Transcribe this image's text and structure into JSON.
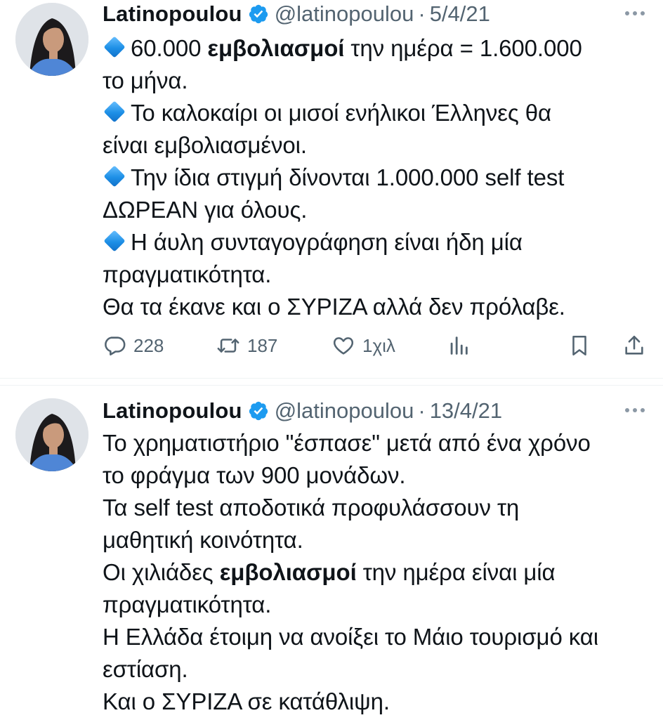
{
  "tweets": [
    {
      "author": "Latinopoulou",
      "handle": "@latinopoulou",
      "separator": "·",
      "date": "5/4/21",
      "lines": {
        "l1_pre": "60.000 ",
        "l1_bold": "εμβολιασμοί",
        "l1_post": " την ημέρα = 1.600.000",
        "l2": "το μήνα.",
        "l3": "Το καλοκαίρι οι μισοί ενήλικοι Έλληνες θα",
        "l4": "είναι εμβολιασμένοι.",
        "l5": "Την ίδια στιγμή δίνονται 1.000.000 self test",
        "l6": "ΔΩΡΕΑΝ για όλους.",
        "l7": "Η άυλη συνταγογράφηση είναι ήδη μία",
        "l8": "πραγματικότητα.",
        "l9": "Θα τα έκανε και ο ΣΥΡΙΖΑ αλλά δεν πρόλαβε."
      },
      "stats": {
        "replies": "228",
        "retweets": "187",
        "likes": "1χιλ"
      }
    },
    {
      "author": "Latinopoulou",
      "handle": "@latinopoulou",
      "separator": "·",
      "date": "13/4/21",
      "lines": {
        "l1": "Το χρηματιστήριο \"έσπασε\" μετά από ένα χρόνο",
        "l2": "το φράγμα των 900 μονάδων.",
        "l3": "Τα self test αποδοτικά προφυλάσσουν τη",
        "l4": "μαθητική κοινότητα.",
        "l5_pre": "Οι χιλιάδες ",
        "l5_bold": "εμβολιασμοί",
        "l5_post": " την ημέρα είναι μία",
        "l6": "πραγματικότητα.",
        "l7": "Η Ελλάδα έτοιμη να ανοίξει το Μάιο τουρισμό και",
        "l8": "εστίαση.",
        "l9": "Και ο ΣΥΡΙΖΑ σε κατάθλιψη."
      }
    }
  ],
  "icons": {
    "verified": "verified-badge-icon",
    "bullet": "small-blue-diamond-emoji",
    "reply": "reply-icon",
    "retweet": "retweet-icon",
    "like": "heart-icon",
    "views": "views-chart-icon",
    "bookmark": "bookmark-icon",
    "share": "share-icon"
  },
  "colors": {
    "text": "#0f1419",
    "muted": "#536471",
    "verified": "#1d9bf0",
    "divider": "#eff3f4"
  }
}
